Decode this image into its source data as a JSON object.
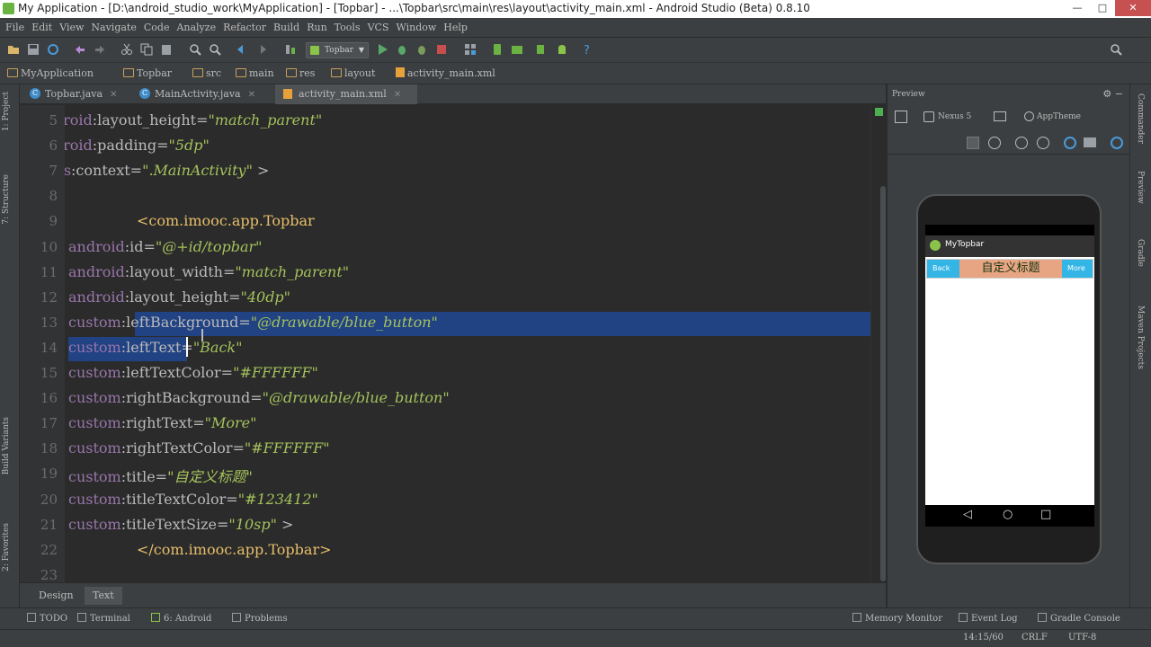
{
  "window": {
    "title": "My Application - [D:\\android_studio_work\\MyApplication] - [Topbar] - ...\\Topbar\\src\\main\\res\\layout\\activity_main.xml - Android Studio (Beta) 0.8.10"
  },
  "menu": [
    "File",
    "Edit",
    "View",
    "Navigate",
    "Code",
    "Analyze",
    "Refactor",
    "Build",
    "Run",
    "Tools",
    "VCS",
    "Window",
    "Help"
  ],
  "toolbar": {
    "run_config": "Topbar"
  },
  "breadcrumb": [
    "MyApplication",
    "Topbar",
    "src",
    "main",
    "res",
    "layout",
    "activity_main.xml"
  ],
  "tabs": [
    {
      "label": "Topbar.java",
      "active": false
    },
    {
      "label": "MainActivity.java",
      "active": false
    },
    {
      "label": "activity_main.xml",
      "active": true
    }
  ],
  "left_tools": [
    "1: Project",
    "7: Structure",
    "Build Variants",
    "2: Favorites"
  ],
  "editor": {
    "lines": [
      {
        "n": "5",
        "indent": 2,
        "ns": "android",
        "attr": "layout_height",
        "val": "match_parent"
      },
      {
        "n": "6",
        "indent": 2,
        "ns": "android",
        "attr": "padding",
        "val": "5dp"
      },
      {
        "n": "7",
        "indent": 2,
        "ns": "tools",
        "attr": "context",
        "val": ".MainActivity",
        "suffix": " >"
      },
      {
        "n": "8"
      },
      {
        "n": "9",
        "indent": 0,
        "tag": "<com.imooc.app.Topbar"
      },
      {
        "n": "10",
        "indent": 1,
        "ns": "android",
        "attr": "id",
        "val": "@+id/topbar"
      },
      {
        "n": "11",
        "indent": 1,
        "ns": "android",
        "attr": "layout_width",
        "val": "match_parent"
      },
      {
        "n": "12",
        "indent": 1,
        "ns": "android",
        "attr": "layout_height",
        "val": "40dp"
      },
      {
        "n": "13",
        "indent": 1,
        "ns": "custom",
        "attr": "leftBackground",
        "val": "@drawable/blue_button"
      },
      {
        "n": "14",
        "indent": 1,
        "ns": "custom",
        "attr": "leftText",
        "val": "Back"
      },
      {
        "n": "15",
        "indent": 1,
        "ns": "custom",
        "attr": "leftTextColor",
        "val": "#FFFFFF"
      },
      {
        "n": "16",
        "indent": 1,
        "ns": "custom",
        "attr": "rightBackground",
        "val": "@drawable/blue_button"
      },
      {
        "n": "17",
        "indent": 1,
        "ns": "custom",
        "attr": "rightText",
        "val": "More"
      },
      {
        "n": "18",
        "indent": 1,
        "ns": "custom",
        "attr": "rightTextColor",
        "val": "#FFFFFF"
      },
      {
        "n": "19",
        "indent": 1,
        "ns": "custom",
        "attr": "title",
        "val": "自定义标题"
      },
      {
        "n": "20",
        "indent": 1,
        "ns": "custom",
        "attr": "titleTextColor",
        "val": "#123412"
      },
      {
        "n": "21",
        "indent": 1,
        "ns": "custom",
        "attr": "titleTextSize",
        "val": "10sp",
        "suffix": " >"
      },
      {
        "n": "22",
        "indent": 0,
        "tag": "</com.imooc.app.Topbar>"
      },
      {
        "n": "23"
      }
    ]
  },
  "editor_tabs": [
    {
      "label": "Design",
      "active": false
    },
    {
      "label": "Text",
      "active": true
    }
  ],
  "preview": {
    "header": "Preview",
    "device": "Nexus 5",
    "theme": "AppTheme",
    "app_title": "MyTopbar",
    "topbar": {
      "left": "Back",
      "title": "自定义标题",
      "right": "More"
    }
  },
  "right_tools": [
    "Commander",
    "Preview",
    "Gradle",
    "Maven Projects"
  ],
  "bottom_tools": [
    "TODO",
    "Terminal",
    "6: Android",
    "Problems",
    "Memory Monitor",
    "Event Log",
    "Gradle Console"
  ],
  "status": {
    "position": "14:15/60",
    "line_sep": "CRLF",
    "encoding": "UTF-8"
  },
  "colors": {
    "bg": "#2b2b2b",
    "selection": "#214283",
    "ns": "#9876aa",
    "value": "#a5c25c",
    "tag": "#e8bf6a",
    "topbar_button": "#33b5e5",
    "topbar_bg": "#e8a583"
  }
}
